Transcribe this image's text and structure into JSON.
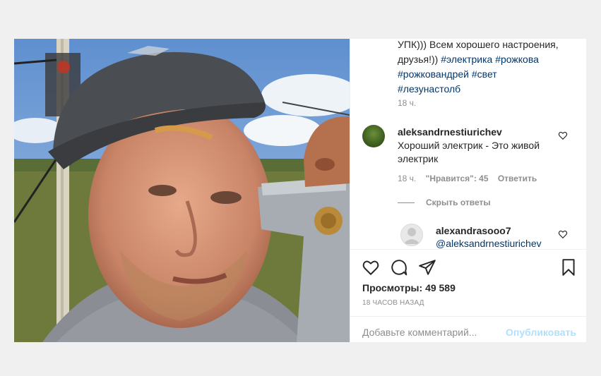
{
  "caption": {
    "lines": [
      [
        {
          "text": "УПК))) Всем хорошего настроения,",
          "type": "text"
        }
      ],
      [
        {
          "text": "друзья!)) ",
          "type": "text"
        },
        {
          "text": "#электрика",
          "type": "hashtag"
        },
        {
          "text": " ",
          "type": "text"
        },
        {
          "text": "#рожкова",
          "type": "hashtag"
        }
      ],
      [
        {
          "text": "#рожковандрей",
          "type": "hashtag"
        },
        {
          "text": " ",
          "type": "text"
        },
        {
          "text": "#свет",
          "type": "hashtag"
        }
      ],
      [
        {
          "text": "#лезунастолб",
          "type": "hashtag"
        }
      ]
    ],
    "time": "18 ч."
  },
  "comment1": {
    "username": "aleksandrnestiurichev",
    "text": "Хороший электрик - Это живой электрик",
    "time": "18 ч.",
    "likes": "\"Нравится\": 45",
    "reply": "Ответить"
  },
  "hide_replies": "Скрыть ответы",
  "reply1": {
    "username": "alexandrasooo7",
    "mention": "@aleksandrnestiurichev"
  },
  "views": {
    "label": "Просмотры:",
    "count": "49 589"
  },
  "time_ago": "18 ЧАСОВ НАЗАД",
  "add_comment": {
    "placeholder": "Добавьте комментарий...",
    "publish": "Опубликовать"
  },
  "colors": {
    "text": "#262626",
    "muted": "#8e8e8e",
    "link": "#00376b",
    "publish_disabled": "#b2dffc"
  },
  "icons": [
    "heart-icon",
    "comment-icon",
    "share-icon",
    "bookmark-icon"
  ]
}
